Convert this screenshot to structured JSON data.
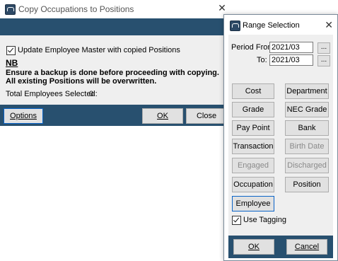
{
  "main_dialog": {
    "title": "Copy Occupations to Positions",
    "close_glyph": "✕",
    "update_checkbox_label": "Update Employee Master with copied Positions",
    "update_checked": true,
    "nb_heading": "NB",
    "warning_text": "Ensure a backup is done before proceeding with copying. All existing Positions will be overwritten.",
    "total_label": "Total Employees Selected:",
    "total_value": "0",
    "options_button": "Options",
    "ok_button": "OK",
    "close_button": "Close"
  },
  "range_dialog": {
    "title": "Range Selection",
    "close_glyph": "✕",
    "period_from_label": "Period From:",
    "period_from_value": "2021/03",
    "to_label": "To:",
    "to_value": "2021/03",
    "browse_glyph": "...",
    "buttons": {
      "cost_centre": "Cost Centre",
      "department": "Department",
      "grade": "Grade",
      "nec_grade": "NEC Grade",
      "pay_point": "Pay Point",
      "bank": "Bank",
      "transaction": "Transaction",
      "birth_date": "Birth Date",
      "engaged": "Engaged",
      "discharged": "Discharged",
      "occupation": "Occupation",
      "position": "Position",
      "employee": "Employee"
    },
    "use_tagging_label": "Use Tagging",
    "use_tagging_checked": true,
    "ok_button": "OK",
    "cancel_button": "Cancel"
  },
  "colors": {
    "band": "#28506f",
    "panel": "#efefef",
    "button": "#e1e1e1",
    "focus_border": "#0a64c8"
  },
  "icons": [
    "app-icon",
    "close-icon",
    "checkbox-checked-icon"
  ]
}
